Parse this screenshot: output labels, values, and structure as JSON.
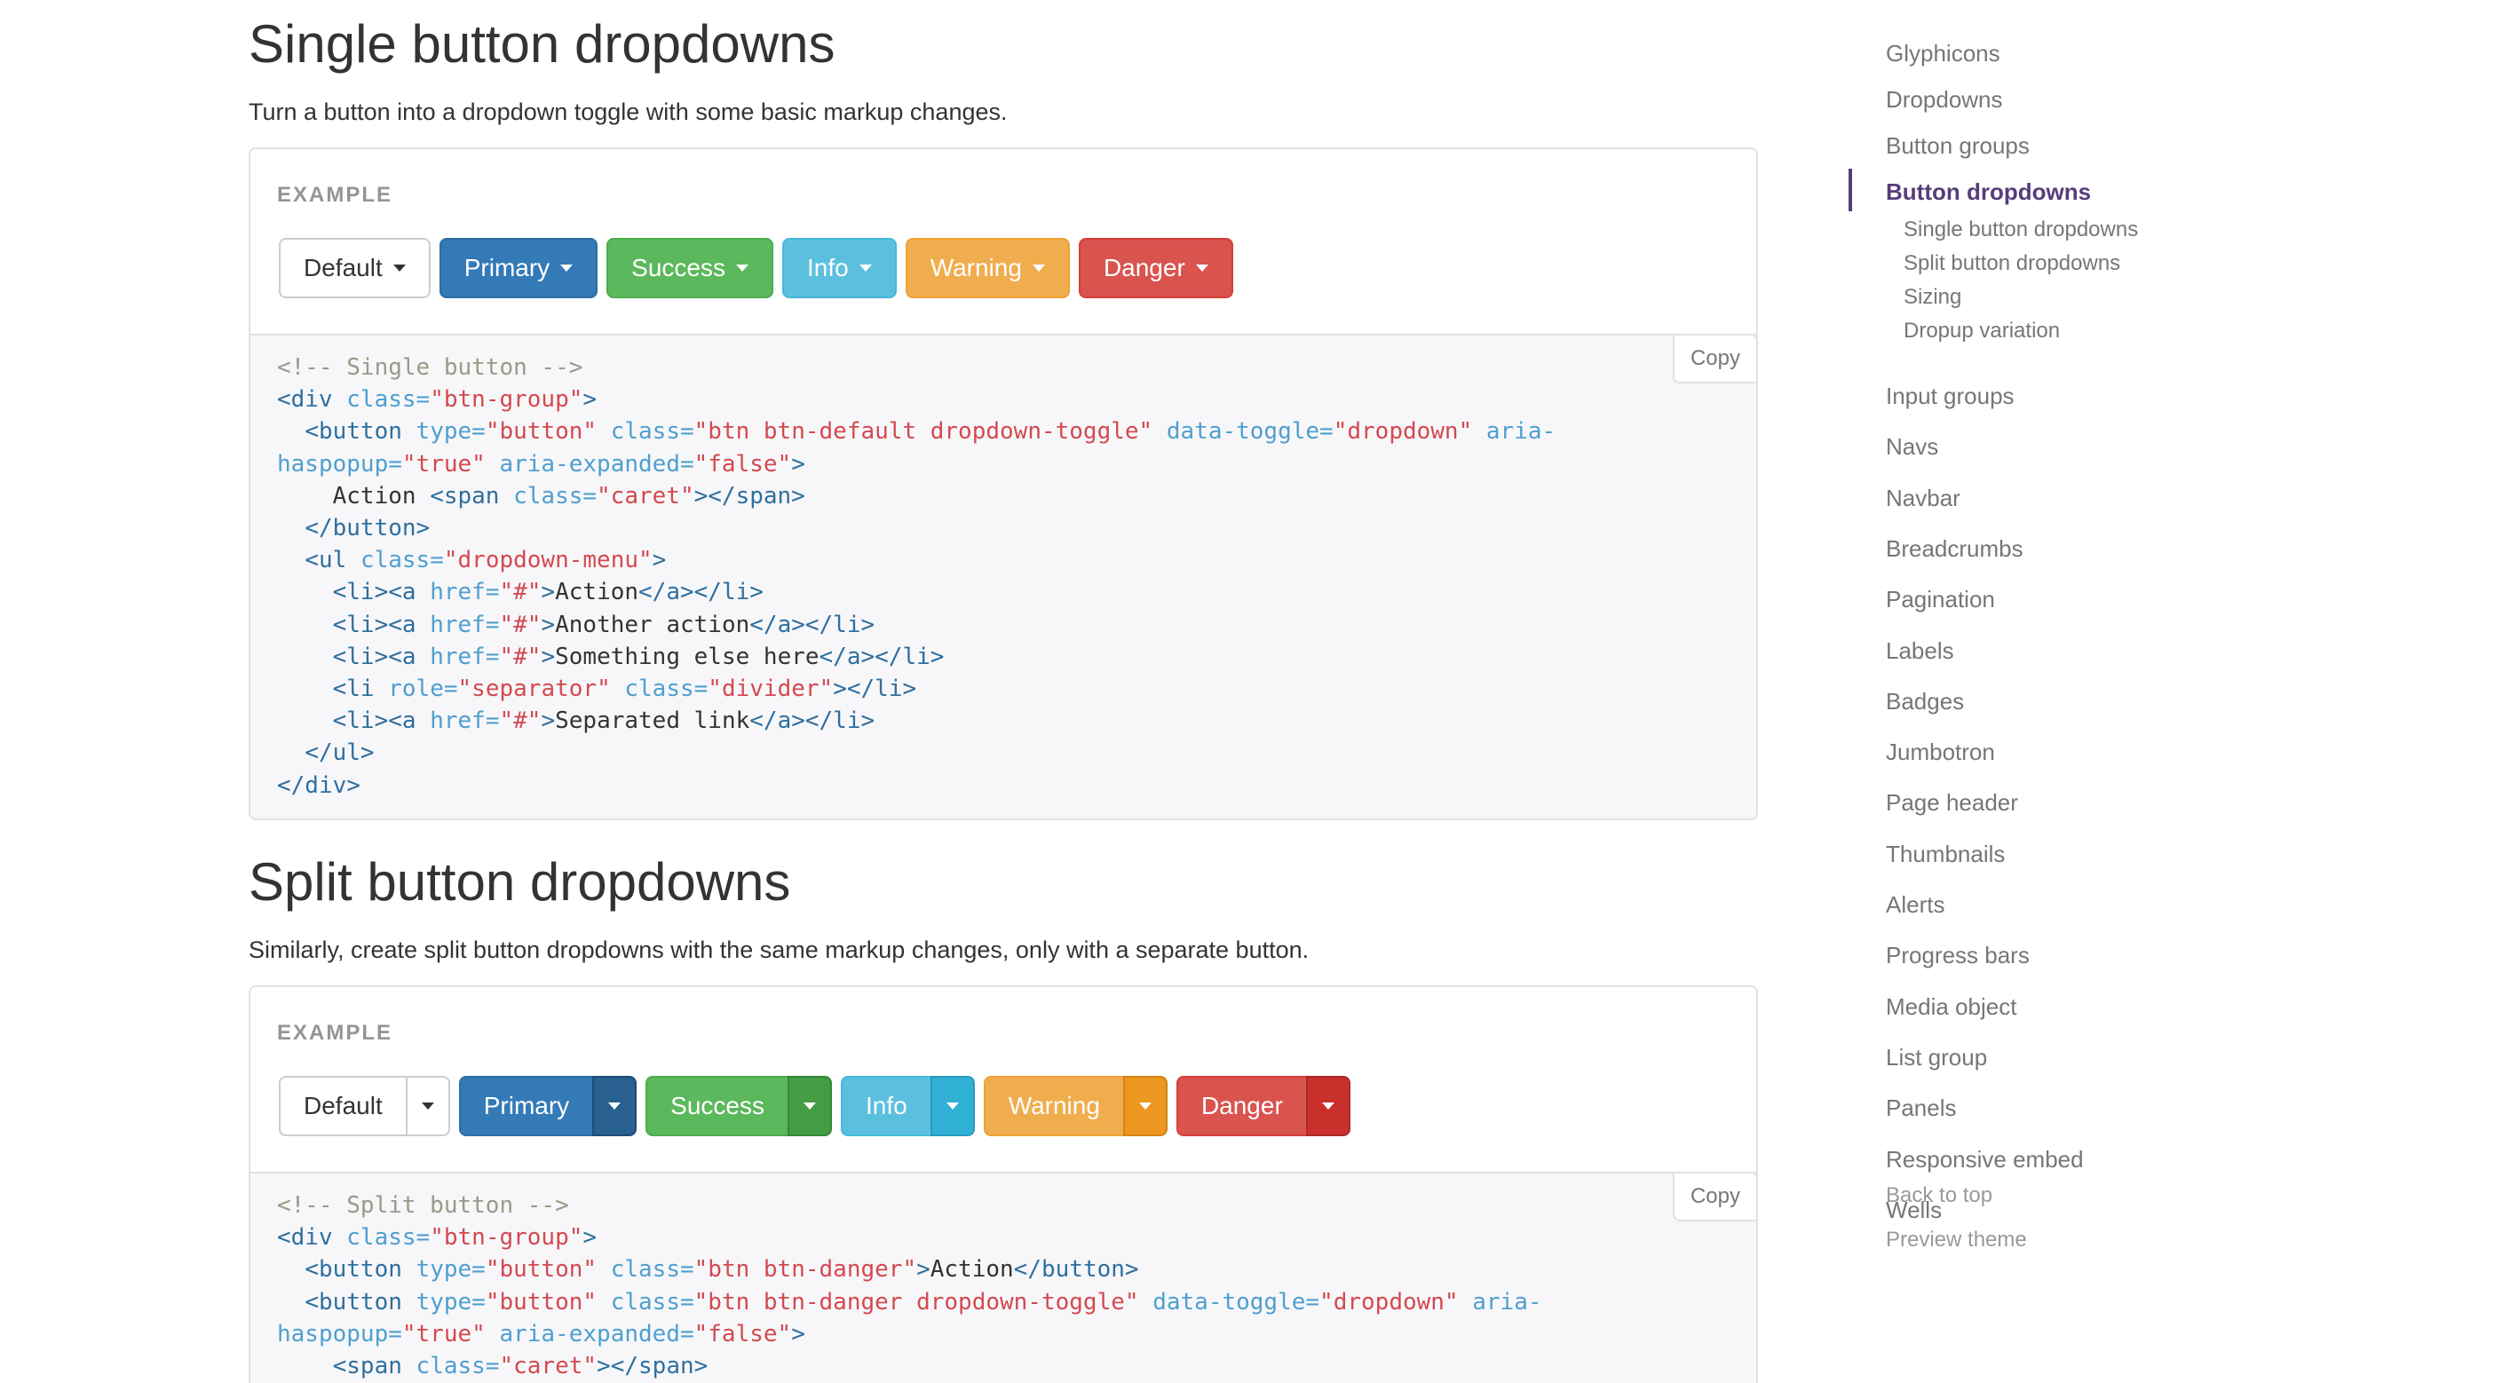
{
  "single": {
    "heading": "Single button dropdowns",
    "lead": "Turn a button into a dropdown toggle with some basic markup changes.",
    "example_label": "EXAMPLE",
    "buttons": [
      "Default",
      "Primary",
      "Success",
      "Info",
      "Warning",
      "Danger"
    ],
    "copy_label": "Copy",
    "code": [
      [
        [
          "comment",
          "<!-- Single button -->"
        ]
      ],
      [
        [
          "tag",
          "<div "
        ],
        [
          "attr",
          "class="
        ],
        [
          "str",
          "\"btn-group\""
        ],
        [
          "tag",
          ">"
        ]
      ],
      [
        [
          "text",
          "  "
        ],
        [
          "tag",
          "<button "
        ],
        [
          "attr",
          "type="
        ],
        [
          "str",
          "\"button\""
        ],
        [
          "text",
          " "
        ],
        [
          "attr",
          "class="
        ],
        [
          "str",
          "\"btn btn-default dropdown-toggle\""
        ],
        [
          "text",
          " "
        ],
        [
          "attr",
          "data-toggle="
        ],
        [
          "str",
          "\"dropdown\""
        ],
        [
          "text",
          " "
        ],
        [
          "attr",
          "aria-"
        ]
      ],
      [
        [
          "attr",
          "haspopup="
        ],
        [
          "str",
          "\"true\""
        ],
        [
          "text",
          " "
        ],
        [
          "attr",
          "aria-expanded="
        ],
        [
          "str",
          "\"false\""
        ],
        [
          "tag",
          ">"
        ]
      ],
      [
        [
          "text",
          "    Action "
        ],
        [
          "tag",
          "<span "
        ],
        [
          "attr",
          "class="
        ],
        [
          "str",
          "\"caret\""
        ],
        [
          "tag",
          "></span>"
        ]
      ],
      [
        [
          "text",
          "  "
        ],
        [
          "tag",
          "</button>"
        ]
      ],
      [
        [
          "text",
          "  "
        ],
        [
          "tag",
          "<ul "
        ],
        [
          "attr",
          "class="
        ],
        [
          "str",
          "\"dropdown-menu\""
        ],
        [
          "tag",
          ">"
        ]
      ],
      [
        [
          "text",
          "    "
        ],
        [
          "tag",
          "<li><a "
        ],
        [
          "attr",
          "href="
        ],
        [
          "str",
          "\"#\""
        ],
        [
          "tag",
          ">"
        ],
        [
          "text",
          "Action"
        ],
        [
          "tag",
          "</a></li>"
        ]
      ],
      [
        [
          "text",
          "    "
        ],
        [
          "tag",
          "<li><a "
        ],
        [
          "attr",
          "href="
        ],
        [
          "str",
          "\"#\""
        ],
        [
          "tag",
          ">"
        ],
        [
          "text",
          "Another action"
        ],
        [
          "tag",
          "</a></li>"
        ]
      ],
      [
        [
          "text",
          "    "
        ],
        [
          "tag",
          "<li><a "
        ],
        [
          "attr",
          "href="
        ],
        [
          "str",
          "\"#\""
        ],
        [
          "tag",
          ">"
        ],
        [
          "text",
          "Something else here"
        ],
        [
          "tag",
          "</a></li>"
        ]
      ],
      [
        [
          "text",
          "    "
        ],
        [
          "tag",
          "<li "
        ],
        [
          "attr",
          "role="
        ],
        [
          "str",
          "\"separator\""
        ],
        [
          "text",
          " "
        ],
        [
          "attr",
          "class="
        ],
        [
          "str",
          "\"divider\""
        ],
        [
          "tag",
          "></li>"
        ]
      ],
      [
        [
          "text",
          "    "
        ],
        [
          "tag",
          "<li><a "
        ],
        [
          "attr",
          "href="
        ],
        [
          "str",
          "\"#\""
        ],
        [
          "tag",
          ">"
        ],
        [
          "text",
          "Separated link"
        ],
        [
          "tag",
          "</a></li>"
        ]
      ],
      [
        [
          "text",
          "  "
        ],
        [
          "tag",
          "</ul>"
        ]
      ],
      [
        [
          "tag",
          "</div>"
        ]
      ]
    ]
  },
  "split": {
    "heading": "Split button dropdowns",
    "lead": "Similarly, create split button dropdowns with the same markup changes, only with a separate button.",
    "example_label": "EXAMPLE",
    "buttons": [
      "Default",
      "Primary",
      "Success",
      "Info",
      "Warning",
      "Danger"
    ],
    "copy_label": "Copy",
    "code": [
      [
        [
          "comment",
          "<!-- Split button -->"
        ]
      ],
      [
        [
          "tag",
          "<div "
        ],
        [
          "attr",
          "class="
        ],
        [
          "str",
          "\"btn-group\""
        ],
        [
          "tag",
          ">"
        ]
      ],
      [
        [
          "text",
          "  "
        ],
        [
          "tag",
          "<button "
        ],
        [
          "attr",
          "type="
        ],
        [
          "str",
          "\"button\""
        ],
        [
          "text",
          " "
        ],
        [
          "attr",
          "class="
        ],
        [
          "str",
          "\"btn btn-danger\""
        ],
        [
          "tag",
          ">"
        ],
        [
          "text",
          "Action"
        ],
        [
          "tag",
          "</button>"
        ]
      ],
      [
        [
          "text",
          "  "
        ],
        [
          "tag",
          "<button "
        ],
        [
          "attr",
          "type="
        ],
        [
          "str",
          "\"button\""
        ],
        [
          "text",
          " "
        ],
        [
          "attr",
          "class="
        ],
        [
          "str",
          "\"btn btn-danger dropdown-toggle\""
        ],
        [
          "text",
          " "
        ],
        [
          "attr",
          "data-toggle="
        ],
        [
          "str",
          "\"dropdown\""
        ],
        [
          "text",
          " "
        ],
        [
          "attr",
          "aria-"
        ]
      ],
      [
        [
          "attr",
          "haspopup="
        ],
        [
          "str",
          "\"true\""
        ],
        [
          "text",
          " "
        ],
        [
          "attr",
          "aria-expanded="
        ],
        [
          "str",
          "\"false\""
        ],
        [
          "tag",
          ">"
        ]
      ],
      [
        [
          "text",
          "    "
        ],
        [
          "tag",
          "<span "
        ],
        [
          "attr",
          "class="
        ],
        [
          "str",
          "\"caret\""
        ],
        [
          "tag",
          "></span>"
        ]
      ]
    ]
  },
  "sidebar": {
    "items_top": [
      "Glyphicons",
      "Dropdowns",
      "Button groups"
    ],
    "active": "Button dropdowns",
    "subitems": [
      "Single button dropdowns",
      "Split button dropdowns",
      "Sizing",
      "Dropup variation"
    ],
    "items_bottom": [
      "Input groups",
      "Navs",
      "Navbar",
      "Breadcrumbs",
      "Pagination",
      "Labels",
      "Badges",
      "Jumbotron",
      "Page header",
      "Thumbnails",
      "Alerts",
      "Progress bars",
      "Media object",
      "List group",
      "Panels",
      "Responsive embed",
      "Wells"
    ],
    "back_to_top": "Back to top",
    "preview_theme": "Preview theme"
  },
  "colors": {
    "default": "#ffffff",
    "primary": "#337ab7",
    "success": "#5cb85c",
    "info": "#5bc0de",
    "warning": "#f0ad4e",
    "danger": "#d9534f",
    "sidebar_active": "#563d7c"
  }
}
